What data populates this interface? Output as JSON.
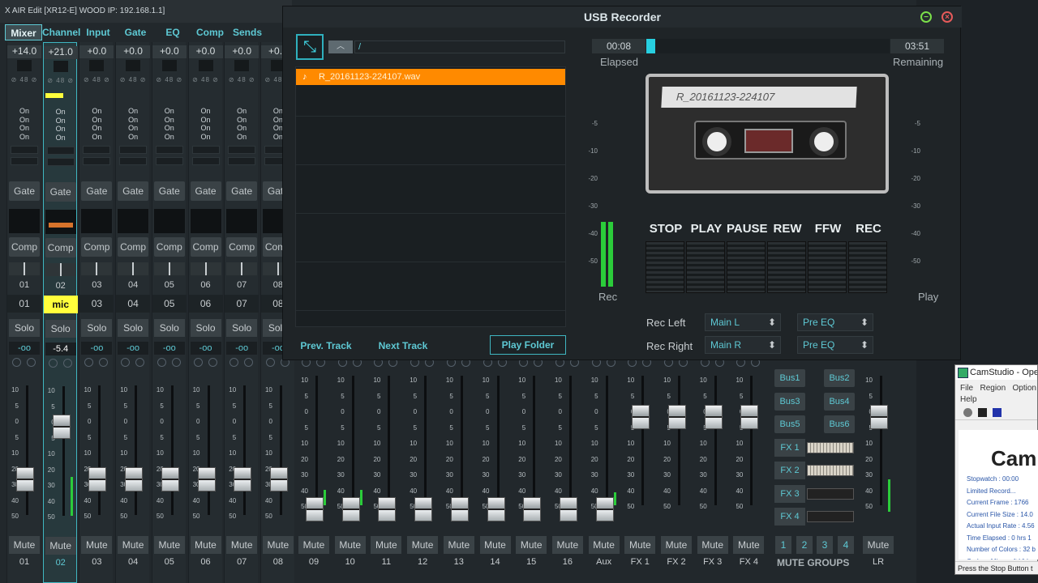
{
  "window_title": "X AIR Edit [XR12-E] WOOD IP: 192.168.1.1]",
  "tabs": [
    "Mixer",
    "Channel",
    "Input",
    "Gate",
    "EQ",
    "Comp",
    "Sends"
  ],
  "channels": [
    {
      "gain": "+14.0",
      "num": "01",
      "name": "01",
      "solo": "Solo",
      "level": "-oo",
      "mute": "Mute",
      "label": "01",
      "fader": 0.22,
      "meter": 0
    },
    {
      "gain": "+21.0",
      "num": "02",
      "name": "mic",
      "solo": "Solo",
      "level": "-5.4",
      "mute": "Mute",
      "label": "02",
      "fader": 0.73,
      "meter": 0.3
    },
    {
      "gain": "+0.0",
      "num": "03",
      "name": "03",
      "solo": "Solo",
      "level": "-oo",
      "mute": "Mute",
      "label": "03",
      "fader": 0.22,
      "meter": 0
    },
    {
      "gain": "+0.0",
      "num": "04",
      "name": "04",
      "solo": "Solo",
      "level": "-oo",
      "mute": "Mute",
      "label": "04",
      "fader": 0.22,
      "meter": 0
    },
    {
      "gain": "+0.0",
      "num": "05",
      "name": "05",
      "solo": "Solo",
      "level": "-oo",
      "mute": "Mute",
      "label": "05",
      "fader": 0.22,
      "meter": 0
    },
    {
      "gain": "+0.0",
      "num": "06",
      "name": "06",
      "solo": "Solo",
      "level": "-oo",
      "mute": "Mute",
      "label": "06",
      "fader": 0.22,
      "meter": 0
    },
    {
      "gain": "+0.0",
      "num": "07",
      "name": "07",
      "solo": "Solo",
      "level": "-oo",
      "mute": "Mute",
      "label": "07",
      "fader": 0.22,
      "meter": 0
    },
    {
      "gain": "+0.0",
      "num": "08",
      "name": "08",
      "solo": "Solo",
      "level": "-oo",
      "mute": "Mute",
      "label": "08",
      "fader": 0.22,
      "meter": 0
    }
  ],
  "on_text": "On",
  "gate_label": "Gate",
  "comp_label": "Comp",
  "lower_strips": [
    {
      "mute": "Mute",
      "label": "09",
      "meter": 0.12
    },
    {
      "mute": "Mute",
      "label": "10",
      "meter": 0.12
    },
    {
      "mute": "Mute",
      "label": "11",
      "meter": 0
    },
    {
      "mute": "Mute",
      "label": "12",
      "meter": 0
    },
    {
      "mute": "Mute",
      "label": "13",
      "meter": 0
    },
    {
      "mute": "Mute",
      "label": "14",
      "meter": 0
    },
    {
      "mute": "Mute",
      "label": "15",
      "meter": 0
    },
    {
      "mute": "Mute",
      "label": "16",
      "meter": 0
    },
    {
      "mute": "Mute",
      "label": "Aux",
      "meter": 0.1
    },
    {
      "mute": "Mute",
      "label": "FX 1",
      "meter": 0
    },
    {
      "mute": "Mute",
      "label": "FX 2",
      "meter": 0
    },
    {
      "mute": "Mute",
      "label": "FX 3",
      "meter": 0
    },
    {
      "mute": "Mute",
      "label": "FX 4",
      "meter": 0
    }
  ],
  "fader_scale": [
    "10",
    "5",
    "0",
    "5",
    "10",
    "20",
    "30",
    "40",
    "50"
  ],
  "bus_buttons": [
    "Bus1",
    "Bus2",
    "Bus3",
    "Bus4",
    "Bus5",
    "Bus6"
  ],
  "fx_buttons": [
    "FX 1",
    "FX 2",
    "FX 3",
    "FX 4"
  ],
  "mute_groups": {
    "buttons": [
      "1",
      "2",
      "3",
      "4"
    ],
    "label": "MUTE GROUPS"
  },
  "lr": {
    "mute": "Mute",
    "label": "LR"
  },
  "usb": {
    "title": "USB Recorder",
    "path": "/",
    "file": "R_20161123-224107.wav",
    "prev": "Prev. Track",
    "next": "Next Track",
    "play_folder": "Play Folder",
    "elapsed": "00:08",
    "remaining": "03:51",
    "elapsed_label": "Elapsed",
    "remaining_label": "Remaining",
    "progress": 0.035,
    "cassette_label": "R_20161123-224107",
    "transport": [
      "STOP",
      "PLAY",
      "PAUSE",
      "REW",
      "FFW",
      "REC"
    ],
    "rec_label": "Rec",
    "play_label": "Play",
    "meter_scale": [
      "-5",
      "-10",
      "-20",
      "-30",
      "-40",
      "-50"
    ],
    "rec_left_label": "Rec Left",
    "rec_right_label": "Rec Right",
    "rec_left_src": "Main L",
    "rec_right_src": "Main R",
    "rec_left_tap": "Pre EQ",
    "rec_right_tap": "Pre EQ"
  },
  "camstudio": {
    "title": "CamStudio - Open",
    "menu": [
      "File",
      "Region",
      "Option",
      "Help"
    ],
    "logo": "Cam",
    "info": [
      "Stopwatch : 00:00",
      "Limited Record...",
      "Current Frame : 1766",
      "Current File Size : 14.0",
      "Actual Input Rate : 4.56",
      "Time Elapsed : 0 hrs 1",
      "Number of Colors : 32 b",
      "Codec : Microsoft Vide",
      "Dimension : 1920 X 108"
    ],
    "status": "Press the Stop Button t"
  }
}
